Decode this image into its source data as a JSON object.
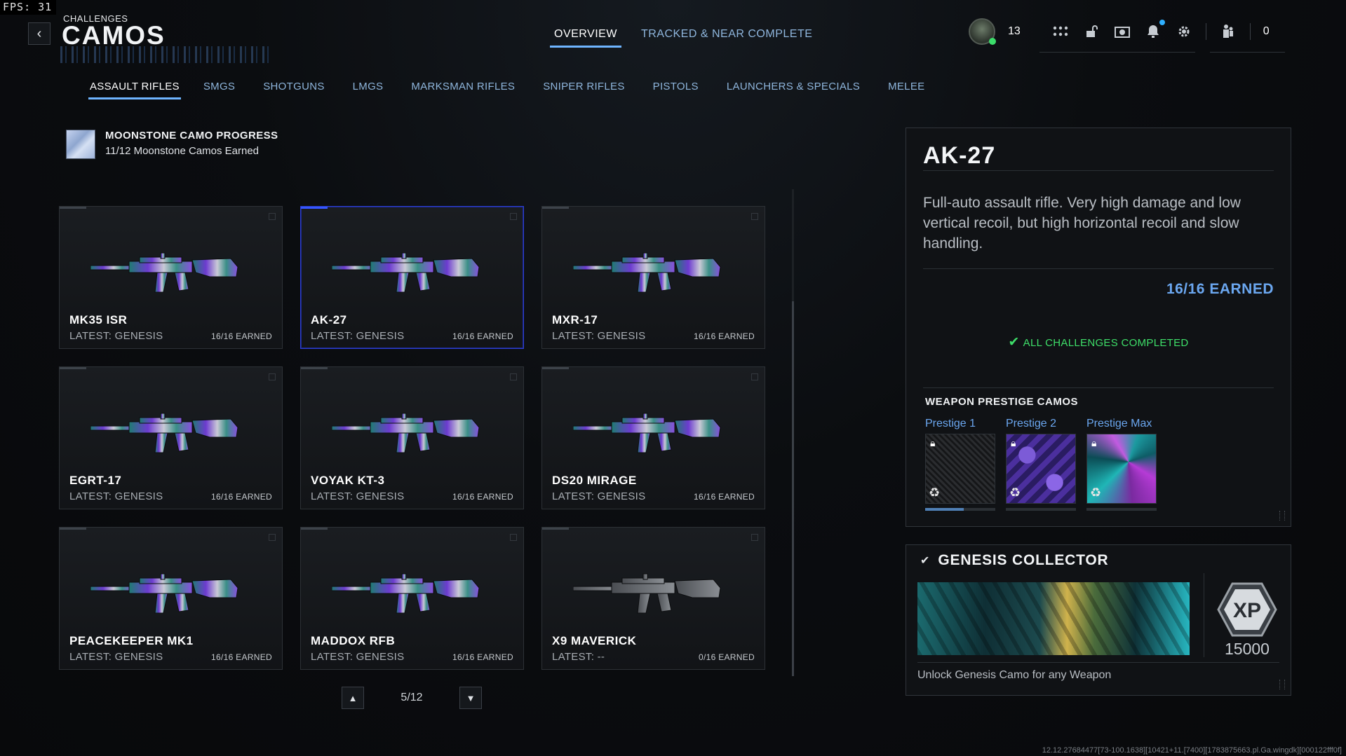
{
  "fps": "FPS:  31",
  "header": {
    "breadcrumb": "CHALLENGES",
    "title": "CAMOS",
    "tabs": [
      {
        "label": "OVERVIEW",
        "active": true
      },
      {
        "label": "TRACKED & NEAR COMPLETE",
        "active": false
      }
    ],
    "player_level": "13",
    "currency": "0",
    "icons": [
      "avatar",
      "grid-icon",
      "unlock-icon",
      "camera-icon",
      "bell-icon",
      "settings-icon",
      "party-icon"
    ]
  },
  "categories": [
    {
      "label": "ASSAULT RIFLES",
      "active": true
    },
    {
      "label": "SMGS",
      "active": false
    },
    {
      "label": "SHOTGUNS",
      "active": false
    },
    {
      "label": "LMGS",
      "active": false
    },
    {
      "label": "MARKSMAN RIFLES",
      "active": false
    },
    {
      "label": "SNIPER RIFLES",
      "active": false
    },
    {
      "label": "PISTOLS",
      "active": false
    },
    {
      "label": "LAUNCHERS & SPECIALS",
      "active": false
    },
    {
      "label": "MELEE",
      "active": false
    }
  ],
  "moonstone": {
    "title": "MOONSTONE CAMO PROGRESS",
    "subtitle": "11/12 Moonstone Camos Earned"
  },
  "weapons": [
    {
      "name": "MK35 ISR",
      "latest": "LATEST: GENESIS",
      "earned": "16/16 EARNED",
      "camo": true
    },
    {
      "name": "AK-27",
      "latest": "LATEST: GENESIS",
      "earned": "16/16 EARNED",
      "camo": true,
      "selected": true
    },
    {
      "name": "MXR-17",
      "latest": "LATEST: GENESIS",
      "earned": "16/16 EARNED",
      "camo": true
    },
    {
      "name": "EGRT-17",
      "latest": "LATEST: GENESIS",
      "earned": "16/16 EARNED",
      "camo": true
    },
    {
      "name": "VOYAK KT-3",
      "latest": "LATEST: GENESIS",
      "earned": "16/16 EARNED",
      "camo": true
    },
    {
      "name": "DS20 MIRAGE",
      "latest": "LATEST: GENESIS",
      "earned": "16/16 EARNED",
      "camo": true
    },
    {
      "name": "PEACEKEEPER MK1",
      "latest": "LATEST: GENESIS",
      "earned": "16/16 EARNED",
      "camo": true
    },
    {
      "name": "MADDOX RFB",
      "latest": "LATEST: GENESIS",
      "earned": "16/16 EARNED",
      "camo": true
    },
    {
      "name": "X9 MAVERICK",
      "latest": "LATEST: --",
      "earned": "0/16 EARNED",
      "camo": false
    }
  ],
  "pager": {
    "text": "5/12"
  },
  "detail": {
    "name": "AK-27",
    "description": "Full-auto assault rifle. Very high damage and low vertical recoil, but high horizontal recoil and slow handling.",
    "earned": "16/16 EARNED",
    "status": "ALL CHALLENGES COMPLETED",
    "prestige_title": "WEAPON PRESTIGE CAMOS",
    "prestige": [
      {
        "label": "Prestige 1",
        "progress": 0.55
      },
      {
        "label": "Prestige 2",
        "progress": 0
      },
      {
        "label": "Prestige Max",
        "progress": 0
      }
    ]
  },
  "collector": {
    "title": "GENESIS COLLECTOR",
    "xp_label": "XP",
    "xp_value": "15000",
    "description": "Unlock Genesis Camo for any Weapon"
  },
  "build_info": "12.12.27684477[73-100.1638][10421+11.[7400][1783875663.pl.Ga.wingdk][000122fff0f]",
  "colors": {
    "accent": "#6fb5ff",
    "earned": "#6ba7f0",
    "complete": "#3ede69",
    "selected_border": "#2d3fd0"
  }
}
